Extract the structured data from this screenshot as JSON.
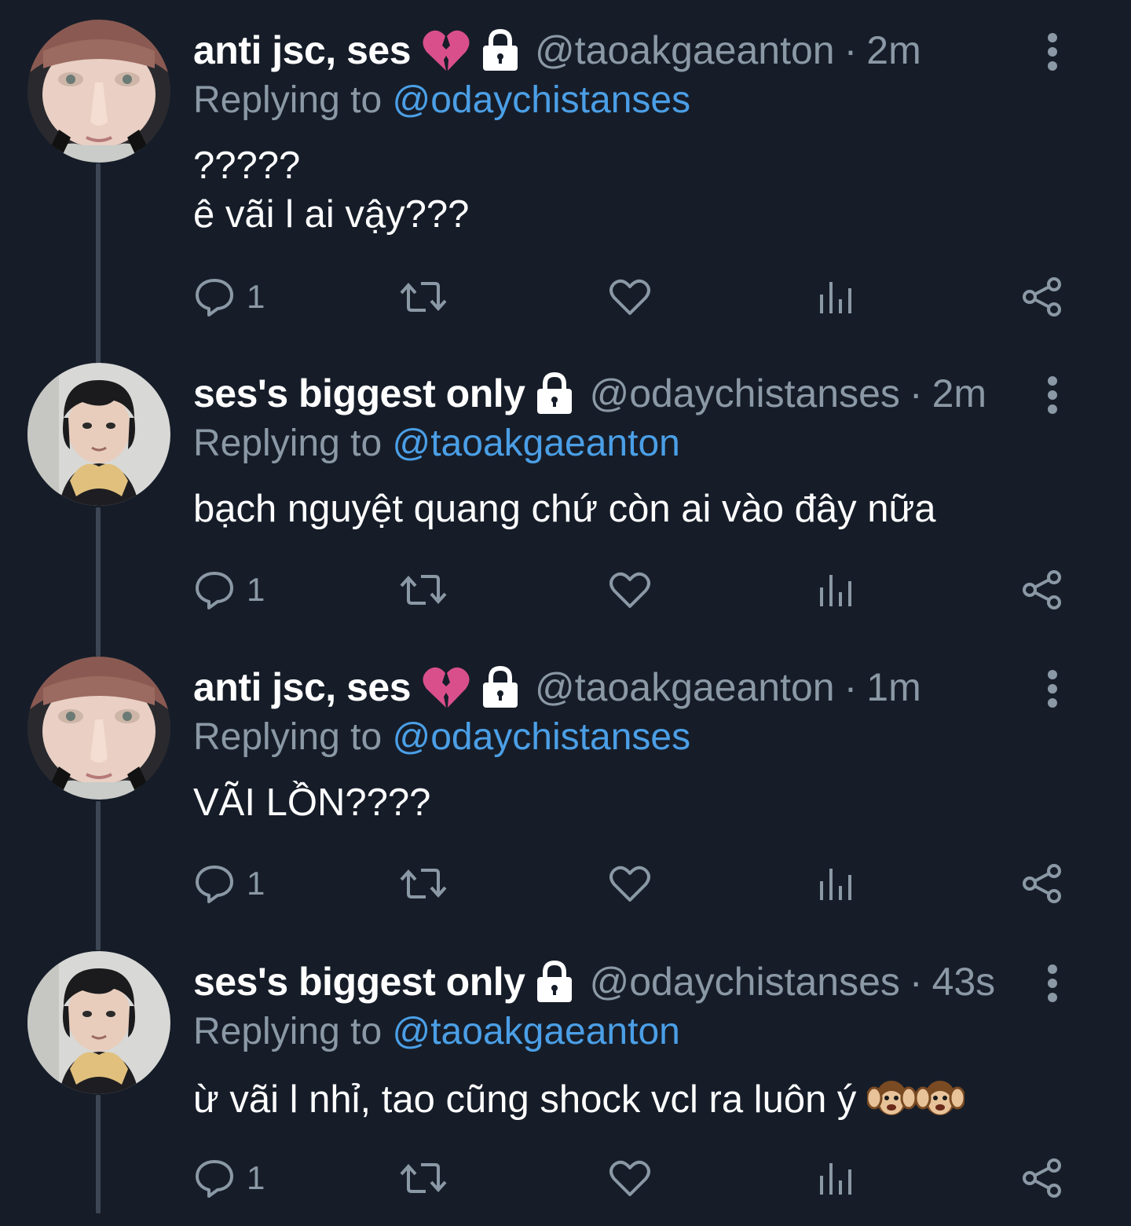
{
  "colors": {
    "background": "#161d29",
    "text_primary": "#ffffff",
    "text_secondary": "#8b98a5",
    "link": "#4b9fe6",
    "thread_line": "#3d4654"
  },
  "tweets": [
    {
      "display_name": "anti jsc, ses",
      "name_emoji": "broken-heart-emoji",
      "protected_icon": "lock-icon",
      "handle": "@taoakgaeanton",
      "separator": "·",
      "time": "2m",
      "reply_prefix": "Replying to",
      "reply_to": "@odaychistanses",
      "text": "?????\nê vãi l ai vậy???",
      "reply_count": "1"
    },
    {
      "display_name": "ses's biggest only",
      "protected_icon": "lock-icon",
      "handle": "@odaychistanses",
      "separator": "·",
      "time": "2m",
      "reply_prefix": "Replying to",
      "reply_to": "@taoakgaeanton",
      "text": "bạch nguyệt quang chứ còn ai vào đây nữa",
      "reply_count": "1"
    },
    {
      "display_name": "anti jsc, ses",
      "name_emoji": "broken-heart-emoji",
      "protected_icon": "lock-icon",
      "handle": "@taoakgaeanton",
      "separator": "·",
      "time": "1m",
      "reply_prefix": "Replying to",
      "reply_to": "@odaychistanses",
      "text": "VÃI LỒN????",
      "reply_count": "1"
    },
    {
      "display_name": "ses's biggest only",
      "protected_icon": "lock-icon",
      "handle": "@odaychistanses",
      "separator": "·",
      "time": "43s",
      "reply_prefix": "Replying to",
      "reply_to": "@taoakgaeanton",
      "text": "ừ vãi l nhỉ, tao cũng shock vcl ra luôn ý",
      "text_emoji": [
        "hear-no-evil-monkey-emoji",
        "hear-no-evil-monkey-emoji"
      ],
      "reply_count": "1"
    }
  ],
  "action_icons": [
    "reply-icon",
    "retweet-icon",
    "like-icon",
    "analytics-icon",
    "share-icon"
  ]
}
